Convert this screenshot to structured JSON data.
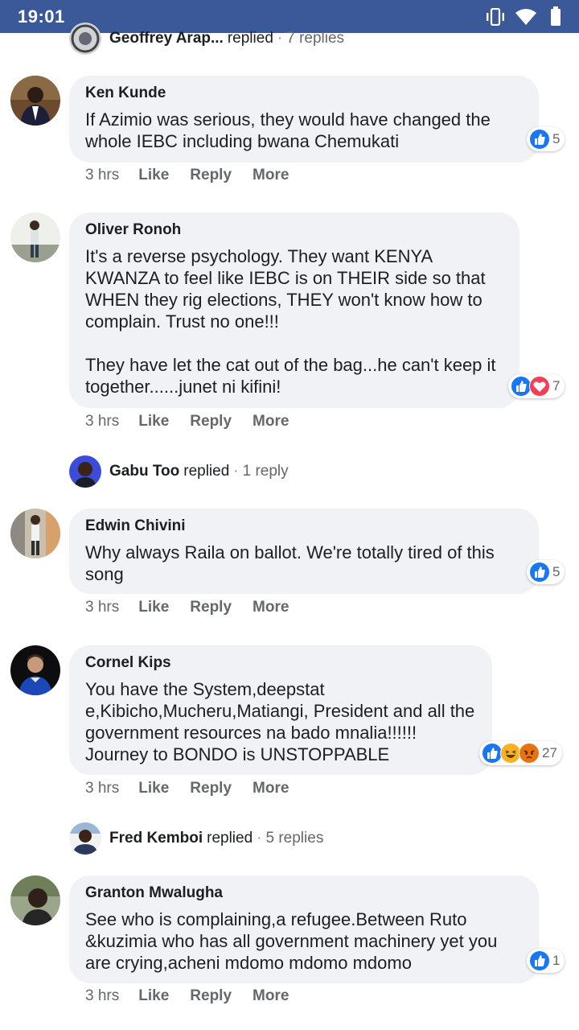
{
  "status_bar": {
    "time": "19:01",
    "icons": [
      "vibrate-icon",
      "wifi-icon",
      "battery-icon"
    ]
  },
  "top_reply": {
    "name": "Geoffrey Arap...",
    "verb": "replied",
    "count": "7 replies"
  },
  "comments": [
    {
      "author": "Ken Kunde",
      "text": "If Azimio was serious, they would have changed the whole IEBC including bwana Chemukati",
      "reactions": [
        "like"
      ],
      "reaction_count": "5",
      "time": "3 hrs",
      "actions": [
        "Like",
        "Reply",
        "More"
      ]
    },
    {
      "author": "Oliver Ronoh",
      "text": "It's a reverse psychology. They want KENYA KWANZA to feel like IEBC is on THEIR side so that WHEN they rig elections, THEY won't know how to complain. Trust no one!!!\n\nThey have let the cat out of the bag...he can't keep it together......junet ni kifini!",
      "reactions": [
        "like",
        "love"
      ],
      "reaction_count": "7",
      "time": "3 hrs",
      "actions": [
        "Like",
        "Reply",
        "More"
      ],
      "reply_summary": {
        "name": "Gabu Too",
        "verb": "replied",
        "count": "1 reply"
      }
    },
    {
      "author": "Edwin Chivini",
      "text": "Why always Raila on ballot. We're totally tired of this song",
      "reactions": [
        "like"
      ],
      "reaction_count": "5",
      "time": "3 hrs",
      "actions": [
        "Like",
        "Reply",
        "More"
      ]
    },
    {
      "author": "Cornel Kips",
      "text": "You have the System,deepstat e,Kibicho,Mucheru,Matiangi, President and all the government resources na bado mnalia!!!!!! Journey to BONDO is UNSTOPPABLE",
      "reactions": [
        "like",
        "haha",
        "angry"
      ],
      "reaction_count": "27",
      "time": "3 hrs",
      "actions": [
        "Like",
        "Reply",
        "More"
      ],
      "reply_summary": {
        "name": "Fred Kemboi",
        "verb": "replied",
        "count": "5 replies"
      }
    },
    {
      "author": "Granton Mwalugha",
      "text": "See who is complaining,a refugee.Between Ruto &kuzimia who has all government machinery yet you are crying,acheni mdomo mdomo mdomo",
      "reactions": [
        "like"
      ],
      "reaction_count": "1",
      "time": "3 hrs",
      "actions": [
        "Like",
        "Reply",
        "More"
      ]
    }
  ],
  "colors": {
    "status_bar": "#3b5998",
    "bubble": "#f0f2f5",
    "like": "#1877f2",
    "love": "#f33e58",
    "haha": "#f7b125",
    "angry": "#e9710f",
    "muted_text": "#65676b"
  }
}
